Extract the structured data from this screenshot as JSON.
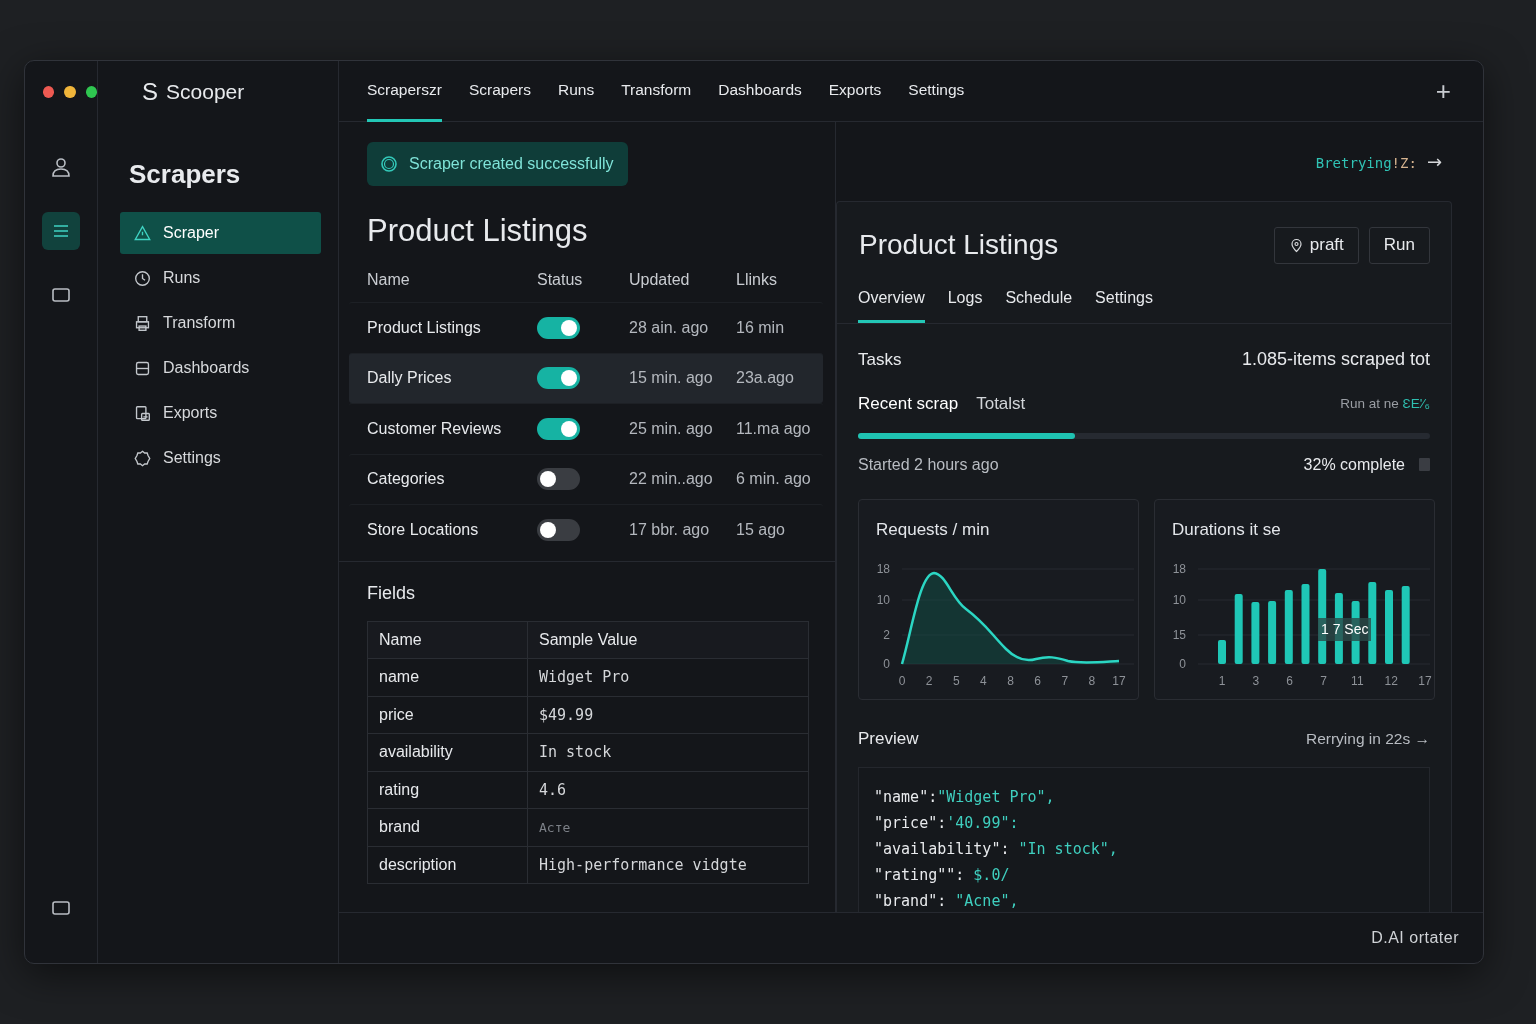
{
  "window": {
    "logo": "S",
    "app_name": "Scooper"
  },
  "rail": [
    {
      "kind": "person",
      "selected": false
    },
    {
      "kind": "menu",
      "selected": true
    },
    {
      "kind": "square",
      "selected": false
    }
  ],
  "rail_bottom": {
    "kind": "square"
  },
  "sidebar": {
    "title": "Scrapers",
    "items": [
      {
        "label": "Scraper",
        "kind": "triangle",
        "selected": true
      },
      {
        "label": "Runs",
        "kind": "clock",
        "selected": false
      },
      {
        "label": "Transform",
        "kind": "printer",
        "selected": false
      },
      {
        "label": "Dashboards",
        "kind": "stack",
        "selected": false
      },
      {
        "label": "Exports",
        "kind": "export",
        "selected": false
      },
      {
        "label": "Settings",
        "kind": "gear",
        "selected": false
      }
    ]
  },
  "tabs": [
    {
      "label": "Scraperszr",
      "selected": true
    },
    {
      "label": "Scrapers",
      "selected": false
    },
    {
      "label": "Runs",
      "selected": false
    },
    {
      "label": "Transform",
      "selected": false
    },
    {
      "label": "Dashboards",
      "selected": false
    },
    {
      "label": "Exports",
      "selected": false
    },
    {
      "label": "Settings",
      "selected": false
    }
  ],
  "add_button": "+",
  "toast": "Scraper created successfully",
  "retry_link": {
    "label": "Bretrying",
    "suffix": "!Z:",
    "arrow": "→"
  },
  "listing": {
    "title": "Product Listings",
    "columns": [
      "Name",
      "Status",
      "Updated",
      "Llinks"
    ],
    "rows": [
      {
        "name": "Product Listings",
        "on": true,
        "updated": "28 ain. ago",
        "links": "16 min",
        "selected": false
      },
      {
        "name": "Dally Prices",
        "on": true,
        "updated": "15 min. ago",
        "links": "23a.ago",
        "selected": true
      },
      {
        "name": "Customer Reviews",
        "on": true,
        "updated": "25 min. ago",
        "links": "11.ma ago",
        "selected": false
      },
      {
        "name": "Categories",
        "on": false,
        "updated": "22 min..ago",
        "links": "6 min. ago",
        "selected": false
      },
      {
        "name": "Store Locations",
        "on": false,
        "updated": "17 bbr. ago",
        "links": "15 ago",
        "selected": false
      }
    ]
  },
  "fields": {
    "title": "Fields",
    "columns": [
      "Name",
      "Sample Value"
    ],
    "rows": [
      {
        "name": "name",
        "value": "Widget Pro",
        "muted": false
      },
      {
        "name": "price",
        "value": "$49.99",
        "muted": false
      },
      {
        "name": "availability",
        "value": "In stock",
        "muted": false
      },
      {
        "name": "rating",
        "value": "4.6",
        "muted": false
      },
      {
        "name": "brand",
        "value": "Асте",
        "muted": true
      },
      {
        "name": "description",
        "value": "High-performance vidgte",
        "muted": false
      }
    ]
  },
  "detail": {
    "title": "Product Listings",
    "buttons": [
      {
        "label": "praft",
        "kind": "pin"
      },
      {
        "label": "Run",
        "kind": "plain"
      }
    ],
    "tabs": [
      {
        "label": "Overview",
        "selected": true
      },
      {
        "label": "Logs",
        "selected": false
      },
      {
        "label": "Schedule",
        "selected": false
      },
      {
        "label": "Settings",
        "selected": false
      }
    ],
    "tasks": {
      "title": "Tasks",
      "summary": "1.085-items scraped tot",
      "subtabs": [
        {
          "label": "Recent scrap",
          "selected": true
        },
        {
          "label": "Totalst",
          "selected": false
        }
      ],
      "run_label": "Run at ne",
      "run_code": "ƐE'⁄₆",
      "level": 0.38,
      "started": "Started 2 hours ago",
      "complete": "32% complete"
    },
    "charts": [
      {
        "kind": "line",
        "title": "Requests / min",
        "y_labels": [
          "18",
          "10",
          "2",
          "0"
        ],
        "x_labels": [
          "0",
          "2",
          "5",
          "4",
          "8",
          "6",
          "7",
          "8",
          "17"
        ]
      },
      {
        "kind": "bar",
        "title": "Durations it se",
        "y_labels": [
          "18",
          "10",
          "15",
          "0"
        ],
        "x_labels": [
          "1",
          "3",
          "6",
          "7",
          "11",
          "12",
          "17"
        ],
        "tooltip": "1 7 Sec"
      }
    ],
    "preview": {
      "title": "Preview",
      "retry": "Rerrying in 22s",
      "arrow": "→",
      "lines": [
        {
          "key": "\"name\"",
          "sep": ":",
          "value": "\"Widget Pro\","
        },
        {
          "key": "\"price\"",
          "sep": ":",
          "value": "'40.99\":"
        },
        {
          "key": "\"availability\"",
          "sep": ": ",
          "value": "\"In stock\","
        },
        {
          "key": "\"rating\"",
          "sep": "\": ",
          "value": "$.0/"
        },
        {
          "key": "\"brand\"",
          "sep": ": ",
          "value": "\"Acne\","
        }
      ]
    }
  },
  "footer": "D.AI ortater"
}
